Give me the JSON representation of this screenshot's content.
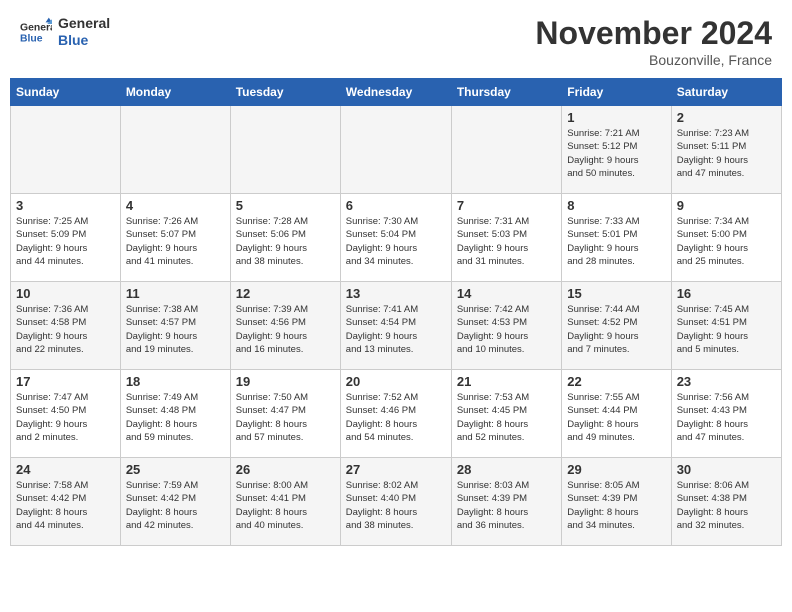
{
  "header": {
    "logo_line1": "General",
    "logo_line2": "Blue",
    "month_title": "November 2024",
    "location": "Bouzonville, France"
  },
  "weekdays": [
    "Sunday",
    "Monday",
    "Tuesday",
    "Wednesday",
    "Thursday",
    "Friday",
    "Saturday"
  ],
  "weeks": [
    [
      {
        "day": "",
        "info": ""
      },
      {
        "day": "",
        "info": ""
      },
      {
        "day": "",
        "info": ""
      },
      {
        "day": "",
        "info": ""
      },
      {
        "day": "",
        "info": ""
      },
      {
        "day": "1",
        "info": "Sunrise: 7:21 AM\nSunset: 5:12 PM\nDaylight: 9 hours\nand 50 minutes."
      },
      {
        "day": "2",
        "info": "Sunrise: 7:23 AM\nSunset: 5:11 PM\nDaylight: 9 hours\nand 47 minutes."
      }
    ],
    [
      {
        "day": "3",
        "info": "Sunrise: 7:25 AM\nSunset: 5:09 PM\nDaylight: 9 hours\nand 44 minutes."
      },
      {
        "day": "4",
        "info": "Sunrise: 7:26 AM\nSunset: 5:07 PM\nDaylight: 9 hours\nand 41 minutes."
      },
      {
        "day": "5",
        "info": "Sunrise: 7:28 AM\nSunset: 5:06 PM\nDaylight: 9 hours\nand 38 minutes."
      },
      {
        "day": "6",
        "info": "Sunrise: 7:30 AM\nSunset: 5:04 PM\nDaylight: 9 hours\nand 34 minutes."
      },
      {
        "day": "7",
        "info": "Sunrise: 7:31 AM\nSunset: 5:03 PM\nDaylight: 9 hours\nand 31 minutes."
      },
      {
        "day": "8",
        "info": "Sunrise: 7:33 AM\nSunset: 5:01 PM\nDaylight: 9 hours\nand 28 minutes."
      },
      {
        "day": "9",
        "info": "Sunrise: 7:34 AM\nSunset: 5:00 PM\nDaylight: 9 hours\nand 25 minutes."
      }
    ],
    [
      {
        "day": "10",
        "info": "Sunrise: 7:36 AM\nSunset: 4:58 PM\nDaylight: 9 hours\nand 22 minutes."
      },
      {
        "day": "11",
        "info": "Sunrise: 7:38 AM\nSunset: 4:57 PM\nDaylight: 9 hours\nand 19 minutes."
      },
      {
        "day": "12",
        "info": "Sunrise: 7:39 AM\nSunset: 4:56 PM\nDaylight: 9 hours\nand 16 minutes."
      },
      {
        "day": "13",
        "info": "Sunrise: 7:41 AM\nSunset: 4:54 PM\nDaylight: 9 hours\nand 13 minutes."
      },
      {
        "day": "14",
        "info": "Sunrise: 7:42 AM\nSunset: 4:53 PM\nDaylight: 9 hours\nand 10 minutes."
      },
      {
        "day": "15",
        "info": "Sunrise: 7:44 AM\nSunset: 4:52 PM\nDaylight: 9 hours\nand 7 minutes."
      },
      {
        "day": "16",
        "info": "Sunrise: 7:45 AM\nSunset: 4:51 PM\nDaylight: 9 hours\nand 5 minutes."
      }
    ],
    [
      {
        "day": "17",
        "info": "Sunrise: 7:47 AM\nSunset: 4:50 PM\nDaylight: 9 hours\nand 2 minutes."
      },
      {
        "day": "18",
        "info": "Sunrise: 7:49 AM\nSunset: 4:48 PM\nDaylight: 8 hours\nand 59 minutes."
      },
      {
        "day": "19",
        "info": "Sunrise: 7:50 AM\nSunset: 4:47 PM\nDaylight: 8 hours\nand 57 minutes."
      },
      {
        "day": "20",
        "info": "Sunrise: 7:52 AM\nSunset: 4:46 PM\nDaylight: 8 hours\nand 54 minutes."
      },
      {
        "day": "21",
        "info": "Sunrise: 7:53 AM\nSunset: 4:45 PM\nDaylight: 8 hours\nand 52 minutes."
      },
      {
        "day": "22",
        "info": "Sunrise: 7:55 AM\nSunset: 4:44 PM\nDaylight: 8 hours\nand 49 minutes."
      },
      {
        "day": "23",
        "info": "Sunrise: 7:56 AM\nSunset: 4:43 PM\nDaylight: 8 hours\nand 47 minutes."
      }
    ],
    [
      {
        "day": "24",
        "info": "Sunrise: 7:58 AM\nSunset: 4:42 PM\nDaylight: 8 hours\nand 44 minutes."
      },
      {
        "day": "25",
        "info": "Sunrise: 7:59 AM\nSunset: 4:42 PM\nDaylight: 8 hours\nand 42 minutes."
      },
      {
        "day": "26",
        "info": "Sunrise: 8:00 AM\nSunset: 4:41 PM\nDaylight: 8 hours\nand 40 minutes."
      },
      {
        "day": "27",
        "info": "Sunrise: 8:02 AM\nSunset: 4:40 PM\nDaylight: 8 hours\nand 38 minutes."
      },
      {
        "day": "28",
        "info": "Sunrise: 8:03 AM\nSunset: 4:39 PM\nDaylight: 8 hours\nand 36 minutes."
      },
      {
        "day": "29",
        "info": "Sunrise: 8:05 AM\nSunset: 4:39 PM\nDaylight: 8 hours\nand 34 minutes."
      },
      {
        "day": "30",
        "info": "Sunrise: 8:06 AM\nSunset: 4:38 PM\nDaylight: 8 hours\nand 32 minutes."
      }
    ]
  ]
}
